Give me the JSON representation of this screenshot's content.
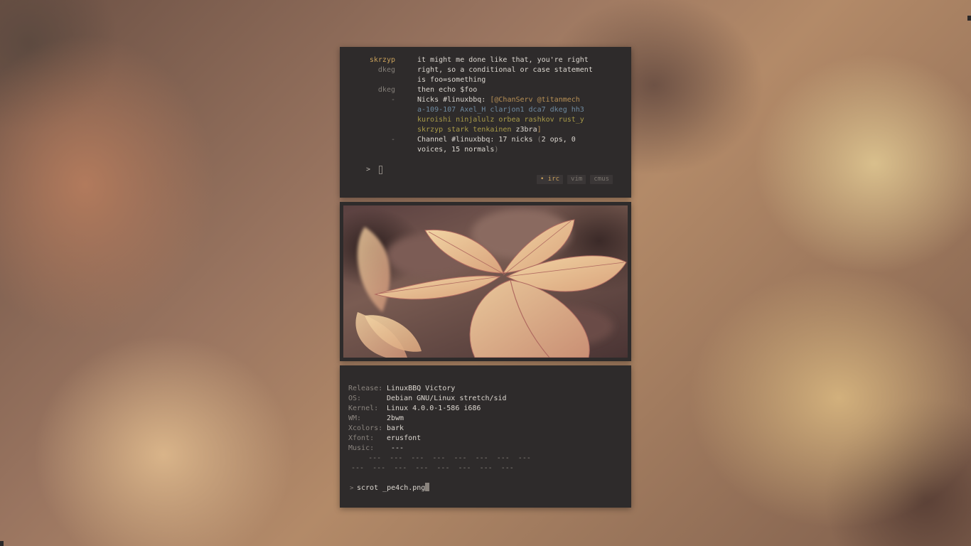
{
  "irc": {
    "lines": [
      {
        "nick": "skrzyp",
        "parts": [
          {
            "t": "it might me done like that, you're right",
            "c": "c-white"
          }
        ],
        "nickClass": "c-nick1"
      },
      {
        "nick": "dkeg",
        "parts": [
          {
            "t": "right, so a conditional or case statement",
            "c": "c-white"
          }
        ],
        "nickClass": "c-nick2"
      },
      {
        "nick": "",
        "parts": [
          {
            "t": "is foo=something",
            "c": "c-white"
          }
        ],
        "nickClass": "c-nick2"
      },
      {
        "nick": "dkeg",
        "parts": [
          {
            "t": "then echo $foo",
            "c": "c-white"
          }
        ],
        "nickClass": "c-nick2"
      },
      {
        "nick": "-",
        "parts": [
          {
            "t": "Nicks #linuxbbq: ",
            "c": "c-white"
          },
          {
            "t": "[@ChanServ @titanmech",
            "c": "c-ops"
          }
        ],
        "nickClass": "c-dash"
      },
      {
        "nick": "",
        "parts": [
          {
            "t": "a-109-107 Axel_H clarjon1 dca7 dkeg hh3",
            "c": "c-voice"
          }
        ],
        "nickClass": "c-dash"
      },
      {
        "nick": "",
        "parts": [
          {
            "t": "kuroishi ninjalulz orbea rashkov rust_y",
            "c": "c-olive"
          }
        ],
        "nickClass": "c-dash"
      },
      {
        "nick": "",
        "parts": [
          {
            "t": "skrzyp stark tenkainen ",
            "c": "c-olive"
          },
          {
            "t": "z3bra",
            "c": "c-white"
          },
          {
            "t": "]",
            "c": "c-ops"
          }
        ],
        "nickClass": "c-dash"
      },
      {
        "nick": "-",
        "parts": [
          {
            "t": "Channel #linuxbbq: 17 nicks ",
            "c": "c-white"
          },
          {
            "t": "(",
            "c": "c-grey"
          },
          {
            "t": "2 ops, 0",
            "c": "c-white"
          }
        ],
        "nickClass": "c-dash"
      },
      {
        "nick": "",
        "parts": [
          {
            "t": "voices, 15 normals",
            "c": "c-white"
          },
          {
            "t": ")",
            "c": "c-grey"
          }
        ],
        "nickClass": "c-dash"
      }
    ],
    "prompt": ">",
    "tabs": [
      {
        "label": "irc",
        "active": true,
        "marker": "•"
      },
      {
        "label": "vim",
        "active": false,
        "marker": ""
      },
      {
        "label": "cmus",
        "active": false,
        "marker": ""
      }
    ]
  },
  "fetch": {
    "rows": [
      {
        "label": "Release:",
        "value": "LinuxBBQ Victory"
      },
      {
        "label": "OS:",
        "value": "Debian GNU/Linux stretch/sid"
      },
      {
        "label": "Kernel:",
        "value": "Linux 4.0.0-1-586 i686"
      },
      {
        "label": "WM:",
        "value": "2bwm"
      },
      {
        "label": "Xcolors:",
        "value": "bark"
      },
      {
        "label": "Xfont:",
        "value": "erusfont"
      },
      {
        "label": "Music:",
        "value": " ---"
      }
    ],
    "dash_row_1": "    ---  ---  ---  ---  ---  ---  ---  ---",
    "dash_row_2": "---  ---  ---  ---  ---  ---  ---  ---",
    "prompt": ">",
    "command": "scrot _pe4ch.png"
  },
  "colors": {
    "terminal_bg": "#2e2b2b",
    "nick_highlight": "#c9a05a",
    "ops": "#b89055",
    "voice": "#6e8aa0",
    "normal": "#a89a48"
  }
}
